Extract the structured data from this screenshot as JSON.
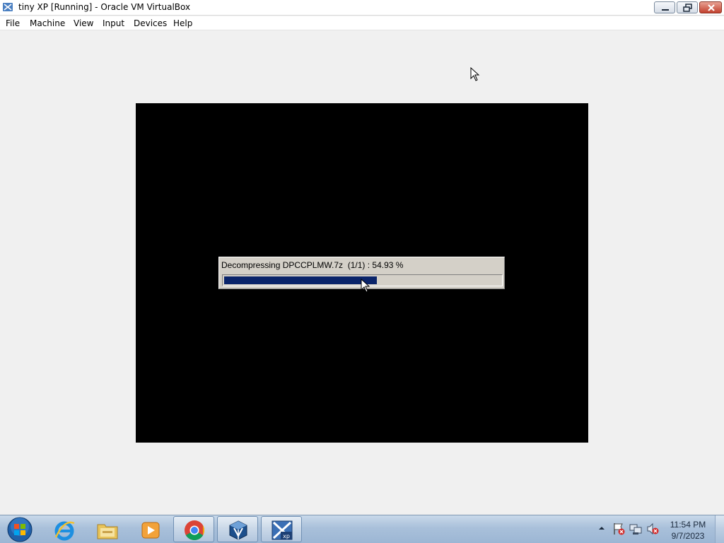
{
  "window": {
    "title": "tiny XP [Running] - Oracle VM VirtualBox",
    "app_icon": "virtualbox-icon",
    "controls": [
      "minimize-icon",
      "restore-icon",
      "close-icon"
    ]
  },
  "menubar": {
    "items": [
      "File",
      "Machine",
      "View",
      "Input",
      "Devices",
      "Help"
    ]
  },
  "vm": {
    "progress": {
      "text": "Decompressing DPCCPLMW.7z  (1/1) : 54.93 %",
      "percent": 54.93,
      "fill_color": "#0a246a"
    }
  },
  "taskbar": {
    "start_icon": "windows-start-orb-icon",
    "items": [
      {
        "icon": "internet-explorer-icon",
        "state": "pinned"
      },
      {
        "icon": "file-explorer-icon",
        "state": "pinned"
      },
      {
        "icon": "media-player-icon",
        "state": "pinned"
      },
      {
        "icon": "chrome-icon",
        "state": "running"
      },
      {
        "icon": "virtualbox-icon",
        "state": "running"
      },
      {
        "icon": "tiny-xp-vm-icon",
        "state": "running"
      }
    ],
    "tray": {
      "icons": [
        "show-hidden-icons-chevron",
        "action-center-alert-icon",
        "network-disconnected-icon",
        "volume-muted-icon"
      ],
      "time": "11:54 PM",
      "date": "9/7/2023"
    }
  }
}
